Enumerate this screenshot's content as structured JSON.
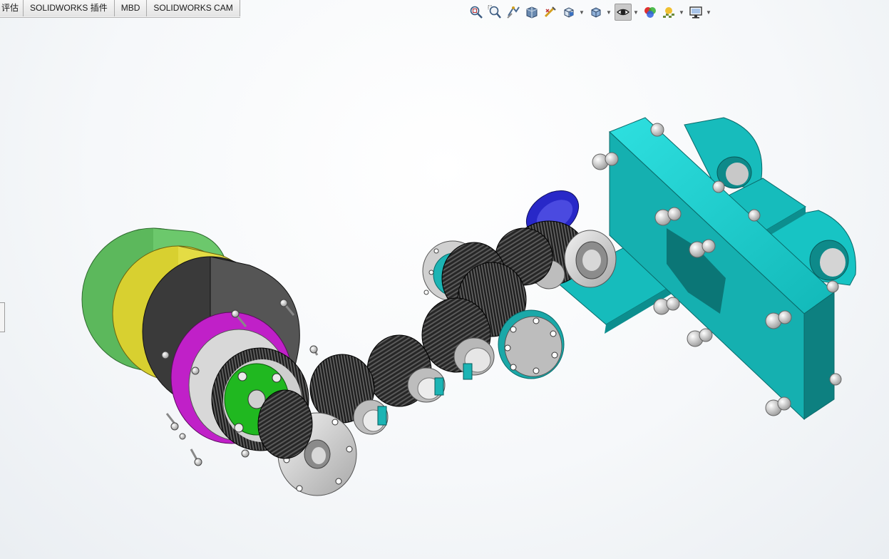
{
  "tabs": [
    {
      "label": "评估"
    },
    {
      "label": "SOLIDWORKS 插件"
    },
    {
      "label": "MBD"
    },
    {
      "label": "SOLIDWORKS CAM"
    }
  ],
  "view_toolbar": {
    "buttons": [
      {
        "icon": "zoom-to-fit-icon"
      },
      {
        "icon": "zoom-to-area-icon"
      },
      {
        "icon": "previous-view-icon"
      },
      {
        "icon": "section-view-icon"
      },
      {
        "icon": "dynamic-annotation-views-icon"
      },
      {
        "icon": "view-orientation-icon",
        "dropdown": true
      },
      {
        "icon": "display-style-icon",
        "dropdown": true
      },
      {
        "icon": "hide-show-items-icon",
        "dropdown": true,
        "active": true
      },
      {
        "icon": "edit-appearance-icon"
      },
      {
        "icon": "apply-scene-icon",
        "dropdown": true
      },
      {
        "icon": "view-settings-icon",
        "dropdown": true
      }
    ]
  },
  "colors": {
    "housing_cyan": "#18c6c6",
    "gear_black": "#1c1c1c",
    "ring_green": "#6cc86c",
    "ring_yellow": "#e0d844",
    "ring_magenta": "#c21ec8",
    "carrier_green": "#24c224",
    "bearing_blue": "#2a2ad0",
    "part_gray": "#c9c9c9"
  }
}
